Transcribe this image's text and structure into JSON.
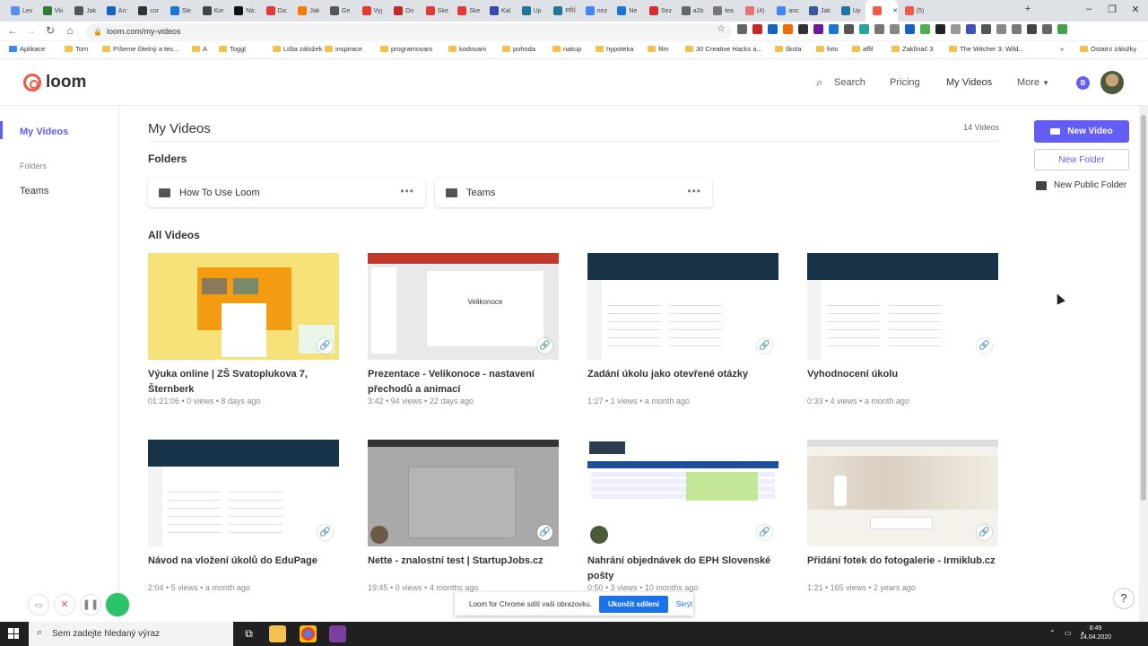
{
  "browser": {
    "tabs": [
      "Lev",
      "Vki",
      "Jak",
      "An:",
      "cor",
      "Sle",
      "Kor",
      "Ná:",
      "Da:",
      "Jak",
      "Ge",
      "Vyj",
      "Do",
      "Ske",
      "Ske",
      "Kal",
      "Up",
      "PŘÍ",
      "nez",
      "Ne",
      "Sez",
      "a2b",
      "tea",
      "(4)",
      "anc",
      "Jak",
      "Up",
      "",
      "(5)"
    ],
    "url": "loom.com/my-videos",
    "bookmarks": [
      "Aplikace",
      "Tom",
      "Píšeme čitelný a tes...",
      "A",
      "Toggl",
      "Lišta záložek",
      "inspirace",
      "programovani",
      "kodovani",
      "pohoda",
      "nakup",
      "hypoteka",
      "film",
      "30 Creative Hacks a...",
      "škola",
      "foto",
      "affil",
      "Zaklínač 3",
      "The Witcher 3: Wild...",
      "»",
      "Ostatní záložky"
    ]
  },
  "header": {
    "brand": "loom",
    "nav": {
      "search": "Search",
      "pricing": "Pricing",
      "my_videos": "My Videos",
      "more": "More"
    },
    "badge": "B"
  },
  "sidebar": {
    "my_videos": "My Videos",
    "folders": "Folders",
    "teams": "Teams"
  },
  "main": {
    "title": "My Videos",
    "count": "14 Videos",
    "folders_title": "Folders",
    "folders": [
      "How To Use Loom",
      "Teams"
    ],
    "all_videos_title": "All Videos",
    "videos": [
      {
        "title": "Výuka online | ZŠ Svatoplukova 7, Šternberk",
        "meta": "01:21:06 • 0 views • 8 days ago",
        "thumb": "yellow"
      },
      {
        "title": "Prezentace - Velikonoce - nastavení přechodů a animací",
        "meta": "3:42 • 94 views • 22 days ago",
        "thumb": "slides",
        "thumb_text": "Velikonoce"
      },
      {
        "title": "Zadání úkolu jako otevřené otázky",
        "meta": "1:27 • 1 views • a month ago",
        "thumb": "edupage"
      },
      {
        "title": "Vyhodnocení úkolu",
        "meta": "0:33 • 4 views • a month ago",
        "thumb": "edupage"
      },
      {
        "title": "Návod na vložení úkolů do EduPage",
        "meta": "2:04 • 5 views • a month ago",
        "thumb": "edupage"
      },
      {
        "title": "Nette - znalostní test | StartupJobs.cz",
        "meta": "19:45 • 0 views • 4 months ago",
        "thumb": "gray"
      },
      {
        "title": "Nahrání objednávek do EPH Slovenské pošty",
        "meta": "0:50 • 3 views • 10 months ago",
        "thumb": "table"
      },
      {
        "title": "Přidání fotek do fotogalerie - Irmiklub.cz",
        "meta": "1:21 • 165 views • 2 years ago",
        "thumb": "photo"
      }
    ]
  },
  "actions": {
    "new_video": "New Video",
    "new_folder": "New Folder",
    "new_public_folder": "New Public Folder"
  },
  "share_bar": {
    "text": "Loom for Chrome sdílí vaši obrazovku.",
    "stop": "Ukončit sdílení",
    "hide": "Skrýt"
  },
  "taskbar": {
    "search_placeholder": "Sem zadejte hledaný výraz",
    "time": "8:49",
    "date": "14.04.2020"
  },
  "colors": {
    "accent": "#625df5",
    "brand": "#f05a46"
  }
}
